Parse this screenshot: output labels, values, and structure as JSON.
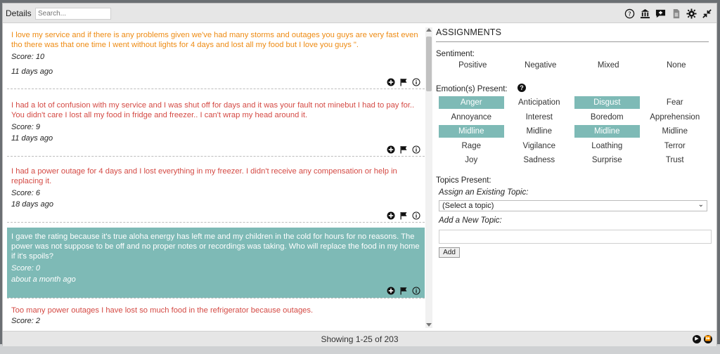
{
  "header": {
    "title": "Details",
    "search_placeholder": "Search...",
    "icons": [
      "help-circle-icon",
      "building-icon",
      "chat-add-icon",
      "document-icon",
      "gear-icon",
      "collapse-icon"
    ]
  },
  "comments": [
    {
      "text": "I love my service and if there is any problems given we've had many storms and outages you guys are very fast even tho there was that one time I went without lights for 4 days and lost all my food but I love you guys \".",
      "score": "Score: 10",
      "age": "11 days ago",
      "color": "#ee8b13",
      "selected": false
    },
    {
      "text": "I had a lot of confusion with my service and I was shut off for days and it was your fault not minebut I had to pay for.. You didn't care I lost all my food in fridge and freezer.. I can't wrap my head around it.",
      "score": "Score: 9",
      "age": "11 days ago",
      "color": "#d44a44",
      "selected": false
    },
    {
      "text": "I had a power outage for 4 days and I lost everything in my freezer. I didn't receive any compensation or help in replacing it.",
      "score": "Score: 6",
      "age": "18 days ago",
      "color": "#d44a44",
      "selected": false
    },
    {
      "text": "I gave the rating because it's true aloha energy has left me and my children in the cold for hours for no reasons. The power was not suppose to be off and no proper notes or recordings was taking. Who will replace the food in my home if it's spoils?",
      "score": "Score: 0",
      "age": "about a month ago",
      "color": "#ffffff",
      "selected": true
    },
    {
      "text": "Too many power outages I have lost so much food in the refrigerator because outages.",
      "score": "Score: 2",
      "age": "",
      "color": "#d44a44",
      "selected": false
    }
  ],
  "assignments": {
    "title": "ASSIGNMENTS",
    "sentiment_label": "Sentiment:",
    "sentiments": [
      "Positive",
      "Negative",
      "Mixed",
      "None"
    ],
    "emotions_label": "Emotion(s) Present:",
    "emotions": [
      {
        "label": "Anger",
        "on": true
      },
      {
        "label": "Anticipation",
        "on": false
      },
      {
        "label": "Disgust",
        "on": true
      },
      {
        "label": "Fear",
        "on": false
      },
      {
        "label": "Annoyance",
        "on": false
      },
      {
        "label": "Interest",
        "on": false
      },
      {
        "label": "Boredom",
        "on": false
      },
      {
        "label": "Apprehension",
        "on": false
      },
      {
        "label": "Midline",
        "on": true
      },
      {
        "label": "Midline",
        "on": false
      },
      {
        "label": "Midline",
        "on": true
      },
      {
        "label": "Midline",
        "on": false
      },
      {
        "label": "Rage",
        "on": false
      },
      {
        "label": "Vigilance",
        "on": false
      },
      {
        "label": "Loathing",
        "on": false
      },
      {
        "label": "Terror",
        "on": false
      },
      {
        "label": "Joy",
        "on": false
      },
      {
        "label": "Sadness",
        "on": false
      },
      {
        "label": "Surprise",
        "on": false
      },
      {
        "label": "Trust",
        "on": false
      }
    ],
    "topics_label": "Topics Present:",
    "existing_label": "Assign an Existing Topic:",
    "select_value": "(Select a topic)",
    "new_label": "Add a New Topic:",
    "add_label": "Add"
  },
  "footer": {
    "showing": "Showing 1-25 of 203"
  },
  "colors": {
    "accent": "#7ebab6",
    "orange": "#ee8b13",
    "red": "#d44a44"
  }
}
